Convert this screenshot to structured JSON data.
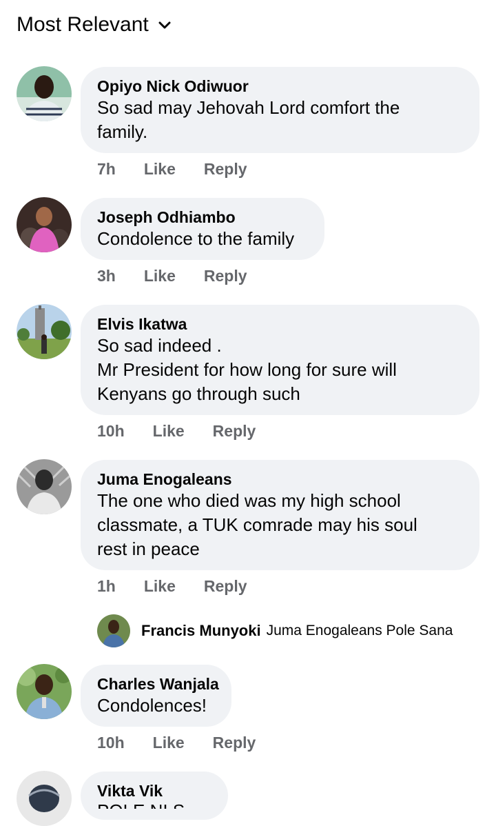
{
  "sort": {
    "label": "Most Relevant",
    "icon": "chevron-down-icon"
  },
  "comments": [
    {
      "author": "Opiyo Nick Odiwuor",
      "lines": [
        "So sad may Jehovah Lord comfort the",
        "family."
      ],
      "time": "7h",
      "like": "Like",
      "reply": "Reply"
    },
    {
      "author": "Joseph Odhiambo",
      "lines": [
        "Condolence to the family"
      ],
      "time": "3h",
      "like": "Like",
      "reply": "Reply"
    },
    {
      "author": "Elvis Ikatwa",
      "lines": [
        "So sad indeed .",
        "Mr President for how long for sure will",
        "Kenyans go through such"
      ],
      "time": "10h",
      "like": "Like",
      "reply": "Reply"
    },
    {
      "author": "Juma Enogaleans",
      "lines": [
        "The one who died was my high school",
        "classmate, a TUK comrade may his soul",
        "rest in peace"
      ],
      "time": "1h",
      "like": "Like",
      "reply": "Reply",
      "reply_preview": {
        "author": "Francis Munyoki",
        "text": "Juma Enogaleans Pole Sana"
      }
    },
    {
      "author": "Charles Wanjala",
      "lines": [
        "Condolences!"
      ],
      "time": "10h",
      "like": "Like",
      "reply": "Reply"
    },
    {
      "author": "Vikta Vik",
      "lines": [
        "POLE NI S..."
      ],
      "time": "",
      "like": "",
      "reply": ""
    }
  ],
  "colors": {
    "bubble": "#f0f2f5",
    "muted": "#65676b",
    "text": "#050505"
  }
}
